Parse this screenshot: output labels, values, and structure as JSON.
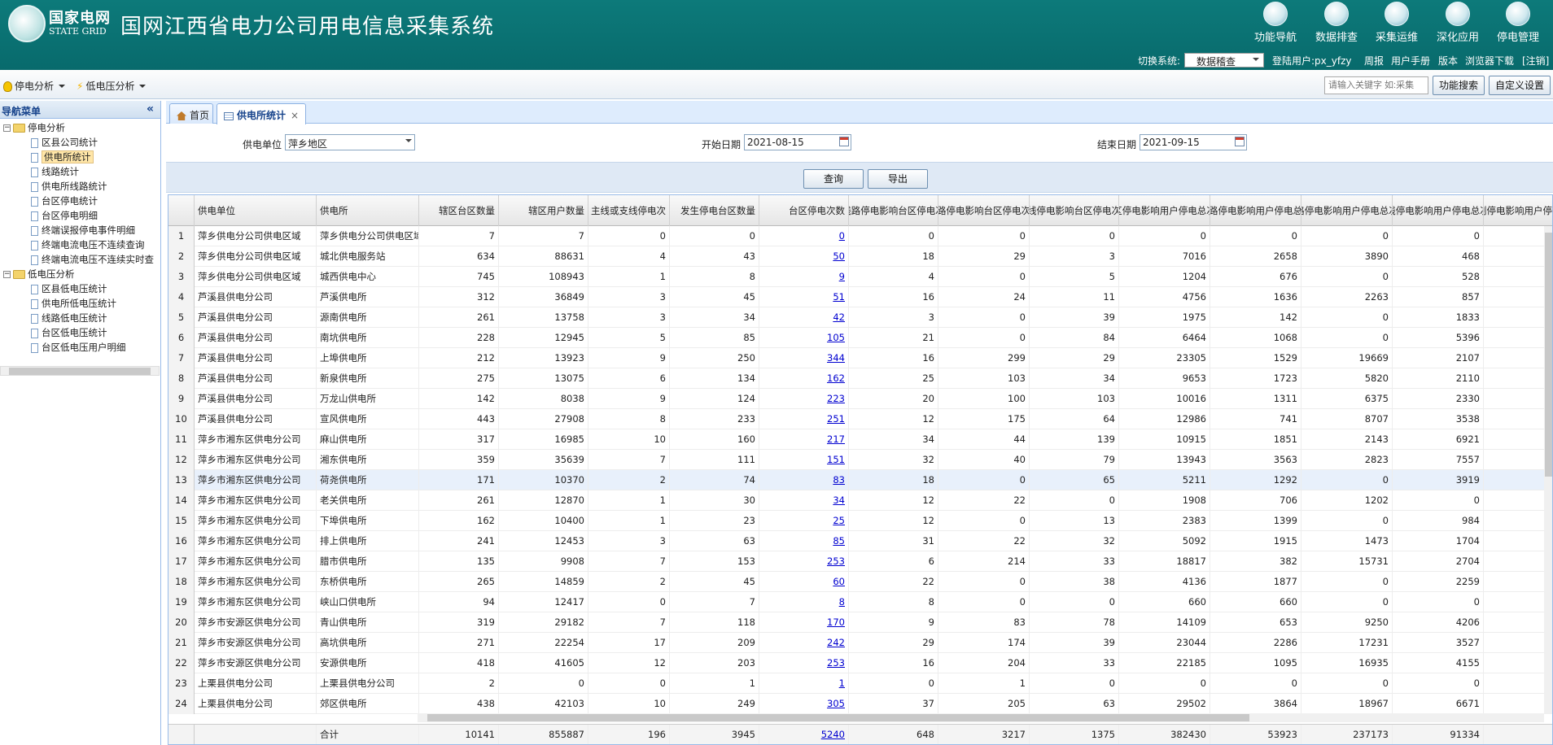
{
  "header": {
    "logo_cn": "国家电网",
    "logo_en": "STATE GRID",
    "title": "国网江西省电力公司用电信息采集系统",
    "nav": [
      {
        "label": "功能导航",
        "icon": "function-nav-icon"
      },
      {
        "label": "数据排查",
        "icon": "data-check-icon"
      },
      {
        "label": "采集运维",
        "icon": "collect-ops-icon"
      },
      {
        "label": "深化应用",
        "icon": "deep-app-icon"
      },
      {
        "label": "停电管理",
        "icon": "outage-mgmt-icon"
      }
    ],
    "switch_label": "切换系统:",
    "switch_value": "数据稽查",
    "user": "登陆用户:px_yfzy",
    "links": [
      "周报",
      "用户手册",
      "版本",
      "浏览器下载",
      "[注销]"
    ]
  },
  "toolbar": {
    "menu1": "停电分析",
    "menu2": "低电压分析",
    "search_placeholder": "请输入关键字 如:采集",
    "search_btn": "功能搜索",
    "custom_btn": "自定义设置"
  },
  "sidebar": {
    "title": "导航菜单",
    "collapse": "«",
    "tree": [
      {
        "t": "停电分析",
        "lvl": 0,
        "type": "folder"
      },
      {
        "t": "区县公司统计",
        "lvl": 1
      },
      {
        "t": "供电所统计",
        "lvl": 1,
        "sel": true
      },
      {
        "t": "线路统计",
        "lvl": 1
      },
      {
        "t": "供电所线路统计",
        "lvl": 1
      },
      {
        "t": "台区停电统计",
        "lvl": 1
      },
      {
        "t": "台区停电明细",
        "lvl": 1
      },
      {
        "t": "终端误报停电事件明细",
        "lvl": 1
      },
      {
        "t": "终端电流电压不连续查询",
        "lvl": 1
      },
      {
        "t": "终端电流电压不连续实时查",
        "lvl": 1
      },
      {
        "t": "低电压分析",
        "lvl": 0,
        "type": "folder"
      },
      {
        "t": "区县低电压统计",
        "lvl": 1
      },
      {
        "t": "供电所低电压统计",
        "lvl": 1
      },
      {
        "t": "线路低电压统计",
        "lvl": 1
      },
      {
        "t": "台区低电压统计",
        "lvl": 1
      },
      {
        "t": "台区低电压用户明细",
        "lvl": 1
      }
    ]
  },
  "tabs": [
    {
      "label": "首页"
    },
    {
      "label": "供电所统计",
      "close": "×"
    }
  ],
  "filter": {
    "unit_label": "供电单位",
    "unit_value": "萍乡地区",
    "start_label": "开始日期",
    "start_value": "2021-08-15",
    "end_label": "结束日期",
    "end_value": "2021-09-15"
  },
  "actions": {
    "query": "查询",
    "export": "导出"
  },
  "grid": {
    "columns": [
      "",
      "供电单位",
      "供电所",
      "辖区台区数量",
      "辖区用户数量",
      "主线或支线停电次",
      "发生停电台区数量",
      "台区停电次数",
      "非线路停电影响台区停电次数",
      "线路停电影响台区停电次数",
      "支线停电影响台区停电次数",
      "台区停电影响用户停电总次数",
      "非线路停电影响用户停电总次数",
      "线路停电影响用户停电总次数",
      "支线停电影响用户停电总次数",
      "计划停电影响用户停电总次"
    ],
    "rows": [
      [
        "1",
        "萍乡供电分公司供电区域",
        "萍乡供电分公司供电区域",
        "7",
        "7",
        "0",
        "0",
        "0",
        "0",
        "0",
        "0",
        "0",
        "0",
        "0",
        "0"
      ],
      [
        "2",
        "萍乡供电分公司供电区域",
        "城北供电服务站",
        "634",
        "88631",
        "4",
        "43",
        "50",
        "18",
        "29",
        "3",
        "7016",
        "2658",
        "3890",
        "468"
      ],
      [
        "3",
        "萍乡供电分公司供电区域",
        "城西供电中心",
        "745",
        "108943",
        "1",
        "8",
        "9",
        "4",
        "0",
        "5",
        "1204",
        "676",
        "0",
        "528"
      ],
      [
        "4",
        "芦溪县供电分公司",
        "芦溪供电所",
        "312",
        "36849",
        "3",
        "45",
        "51",
        "16",
        "24",
        "11",
        "4756",
        "1636",
        "2263",
        "857"
      ],
      [
        "5",
        "芦溪县供电分公司",
        "源南供电所",
        "261",
        "13758",
        "3",
        "34",
        "42",
        "3",
        "0",
        "39",
        "1975",
        "142",
        "0",
        "1833"
      ],
      [
        "6",
        "芦溪县供电分公司",
        "南坑供电所",
        "228",
        "12945",
        "5",
        "85",
        "105",
        "21",
        "0",
        "84",
        "6464",
        "1068",
        "0",
        "5396"
      ],
      [
        "7",
        "芦溪县供电分公司",
        "上埠供电所",
        "212",
        "13923",
        "9",
        "250",
        "344",
        "16",
        "299",
        "29",
        "23305",
        "1529",
        "19669",
        "2107"
      ],
      [
        "8",
        "芦溪县供电分公司",
        "新泉供电所",
        "275",
        "13075",
        "6",
        "134",
        "162",
        "25",
        "103",
        "34",
        "9653",
        "1723",
        "5820",
        "2110"
      ],
      [
        "9",
        "芦溪县供电分公司",
        "万龙山供电所",
        "142",
        "8038",
        "9",
        "124",
        "223",
        "20",
        "100",
        "103",
        "10016",
        "1311",
        "6375",
        "2330"
      ],
      [
        "10",
        "芦溪县供电分公司",
        "宣风供电所",
        "443",
        "27908",
        "8",
        "233",
        "251",
        "12",
        "175",
        "64",
        "12986",
        "741",
        "8707",
        "3538"
      ],
      [
        "11",
        "萍乡市湘东区供电分公司",
        "麻山供电所",
        "317",
        "16985",
        "10",
        "160",
        "217",
        "34",
        "44",
        "139",
        "10915",
        "1851",
        "2143",
        "6921"
      ],
      [
        "12",
        "萍乡市湘东区供电分公司",
        "湘东供电所",
        "359",
        "35639",
        "7",
        "111",
        "151",
        "32",
        "40",
        "79",
        "13943",
        "3563",
        "2823",
        "7557"
      ],
      [
        "13",
        "萍乡市湘东区供电分公司",
        "荷尧供电所",
        "171",
        "10370",
        "2",
        "74",
        "83",
        "18",
        "0",
        "65",
        "5211",
        "1292",
        "0",
        "3919"
      ],
      [
        "14",
        "萍乡市湘东区供电分公司",
        "老关供电所",
        "261",
        "12870",
        "1",
        "30",
        "34",
        "12",
        "22",
        "0",
        "1908",
        "706",
        "1202",
        "0"
      ],
      [
        "15",
        "萍乡市湘东区供电分公司",
        "下埠供电所",
        "162",
        "10400",
        "1",
        "23",
        "25",
        "12",
        "0",
        "13",
        "2383",
        "1399",
        "0",
        "984"
      ],
      [
        "16",
        "萍乡市湘东区供电分公司",
        "排上供电所",
        "241",
        "12453",
        "3",
        "63",
        "85",
        "31",
        "22",
        "32",
        "5092",
        "1915",
        "1473",
        "1704"
      ],
      [
        "17",
        "萍乡市湘东区供电分公司",
        "腊市供电所",
        "135",
        "9908",
        "7",
        "153",
        "253",
        "6",
        "214",
        "33",
        "18817",
        "382",
        "15731",
        "2704"
      ],
      [
        "18",
        "萍乡市湘东区供电分公司",
        "东桥供电所",
        "265",
        "14859",
        "2",
        "45",
        "60",
        "22",
        "0",
        "38",
        "4136",
        "1877",
        "0",
        "2259"
      ],
      [
        "19",
        "萍乡市湘东区供电分公司",
        "峡山口供电所",
        "94",
        "12417",
        "0",
        "7",
        "8",
        "8",
        "0",
        "0",
        "660",
        "660",
        "0",
        "0"
      ],
      [
        "20",
        "萍乡市安源区供电分公司",
        "青山供电所",
        "319",
        "29182",
        "7",
        "118",
        "170",
        "9",
        "83",
        "78",
        "14109",
        "653",
        "9250",
        "4206"
      ],
      [
        "21",
        "萍乡市安源区供电分公司",
        "高坑供电所",
        "271",
        "22254",
        "17",
        "209",
        "242",
        "29",
        "174",
        "39",
        "23044",
        "2286",
        "17231",
        "3527"
      ],
      [
        "22",
        "萍乡市安源区供电分公司",
        "安源供电所",
        "418",
        "41605",
        "12",
        "203",
        "253",
        "16",
        "204",
        "33",
        "22185",
        "1095",
        "16935",
        "4155"
      ],
      [
        "23",
        "上栗县供电分公司",
        "上栗县供电分公司",
        "2",
        "0",
        "0",
        "1",
        "1",
        "0",
        "1",
        "0",
        "0",
        "0",
        "0",
        "0"
      ],
      [
        "24",
        "上栗县供电分公司",
        "郊区供电所",
        "438",
        "42103",
        "10",
        "249",
        "305",
        "37",
        "205",
        "63",
        "29502",
        "3864",
        "18967",
        "6671"
      ]
    ],
    "total": [
      "",
      "",
      "合计",
      "10141",
      "855887",
      "196",
      "3945",
      "5240",
      "648",
      "3217",
      "1375",
      "382430",
      "53923",
      "237173",
      "91334"
    ]
  }
}
